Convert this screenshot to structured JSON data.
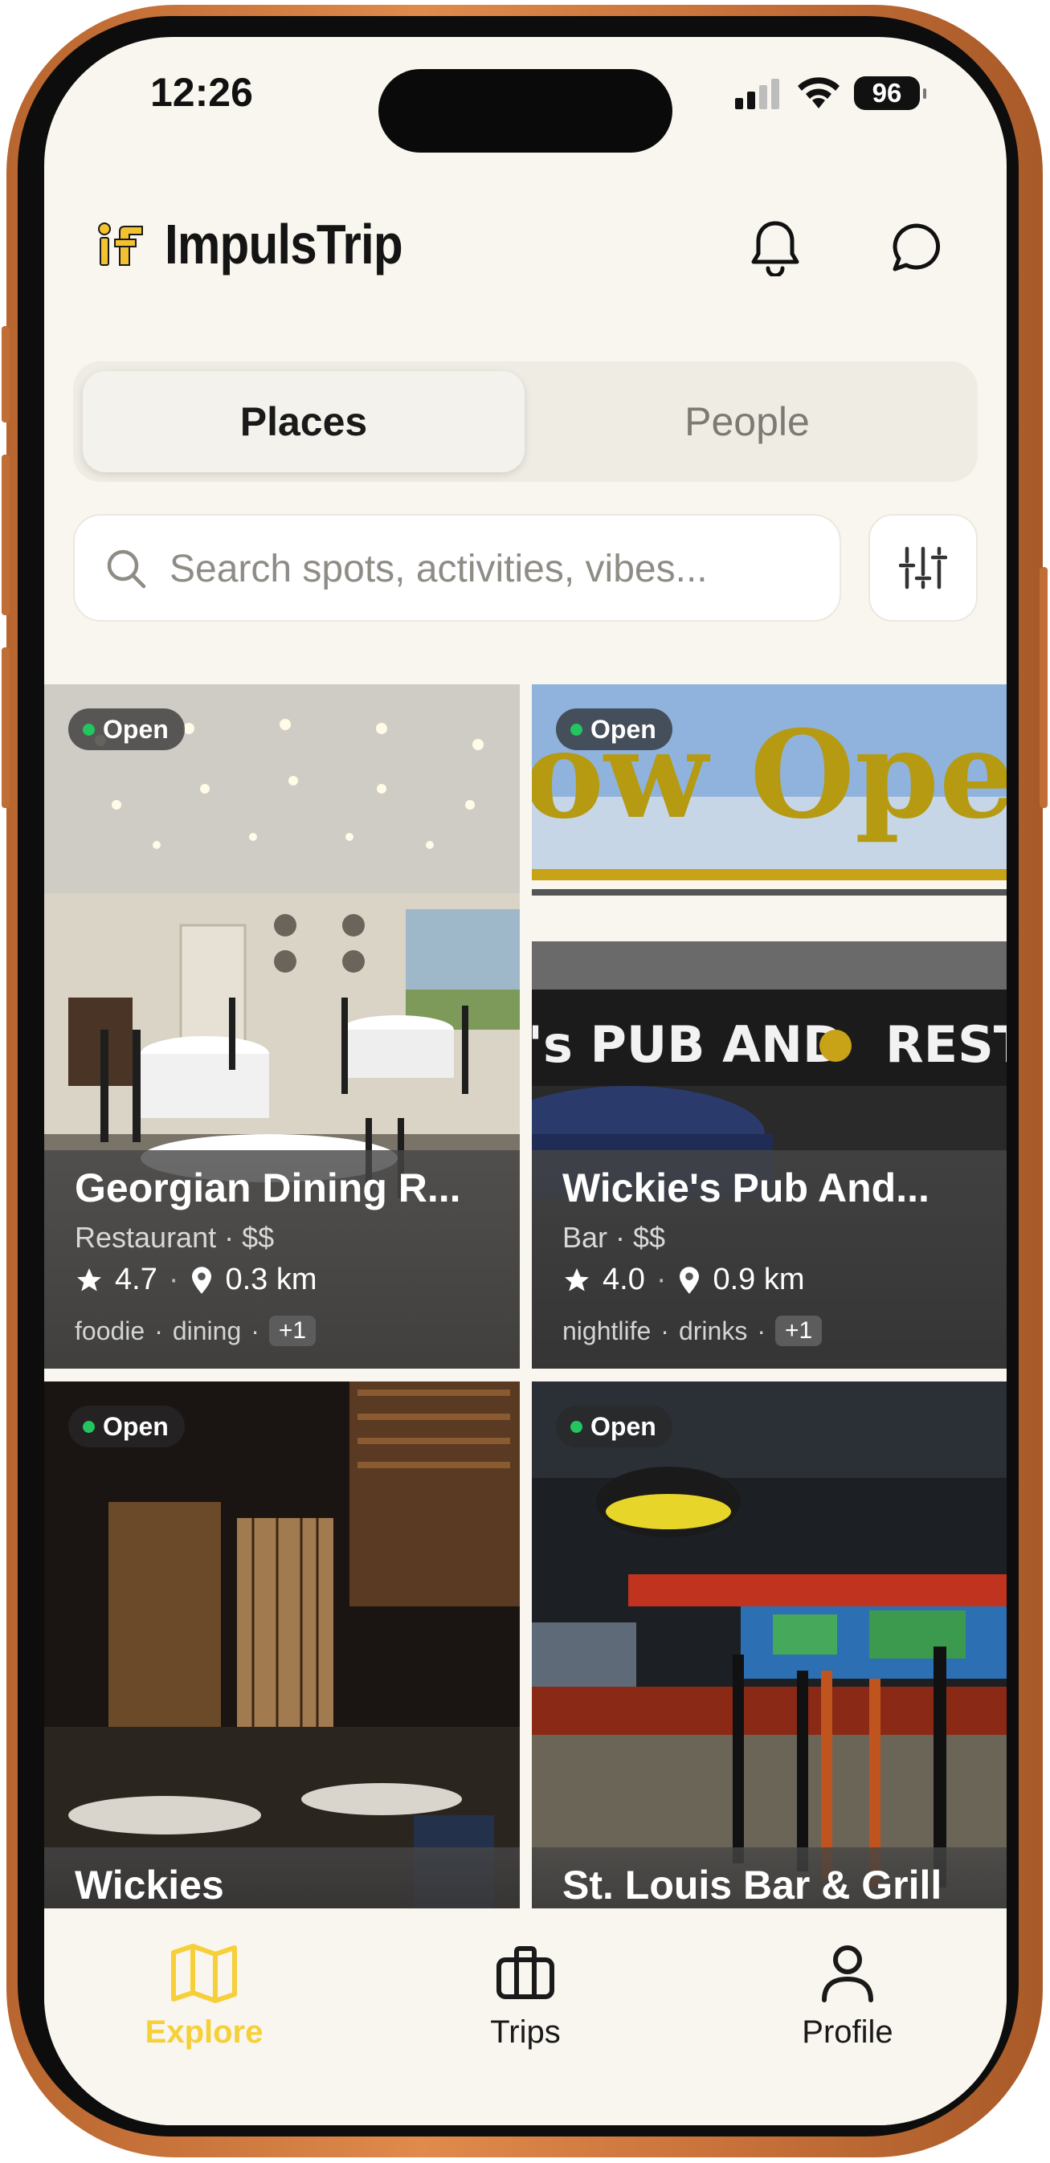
{
  "status_bar": {
    "time": "12:26",
    "battery": "96"
  },
  "header": {
    "app_name": "ImpulsTrip"
  },
  "segmented": {
    "places_label": "Places",
    "people_label": "People",
    "selected": "Places"
  },
  "search": {
    "placeholder": "Search spots, activities, vibes..."
  },
  "cards": [
    {
      "status": "Open",
      "name": "Georgian Dining R...",
      "category": "Restaurant",
      "price": "$$",
      "rating": "4.7",
      "distance": "0.3 km",
      "tags": [
        "foodie",
        "dining"
      ],
      "more": "+1"
    },
    {
      "status": "Open",
      "name": "Wickie's Pub And...",
      "category": "Bar",
      "price": "$$",
      "rating": "4.0",
      "distance": "0.9 km",
      "tags": [
        "nightlife",
        "drinks"
      ],
      "more": "+1",
      "sign_text": "ow Ope",
      "banner_text": "'s PUB AND",
      "banner_text2": "REST"
    },
    {
      "status": "Open",
      "name": "Wickies"
    },
    {
      "status": "Open",
      "name": "St. Louis Bar & Grill"
    }
  ],
  "tabbar": {
    "items": [
      {
        "label": "Explore",
        "icon": "map-icon",
        "active": true
      },
      {
        "label": "Trips",
        "icon": "briefcase-icon",
        "active": false
      },
      {
        "label": "Profile",
        "icon": "person-icon",
        "active": false
      }
    ]
  },
  "colors": {
    "accent": "#f6cf39",
    "background": "#f9f6ef",
    "open_dot": "#22c55e",
    "frame": "#c8713a"
  }
}
